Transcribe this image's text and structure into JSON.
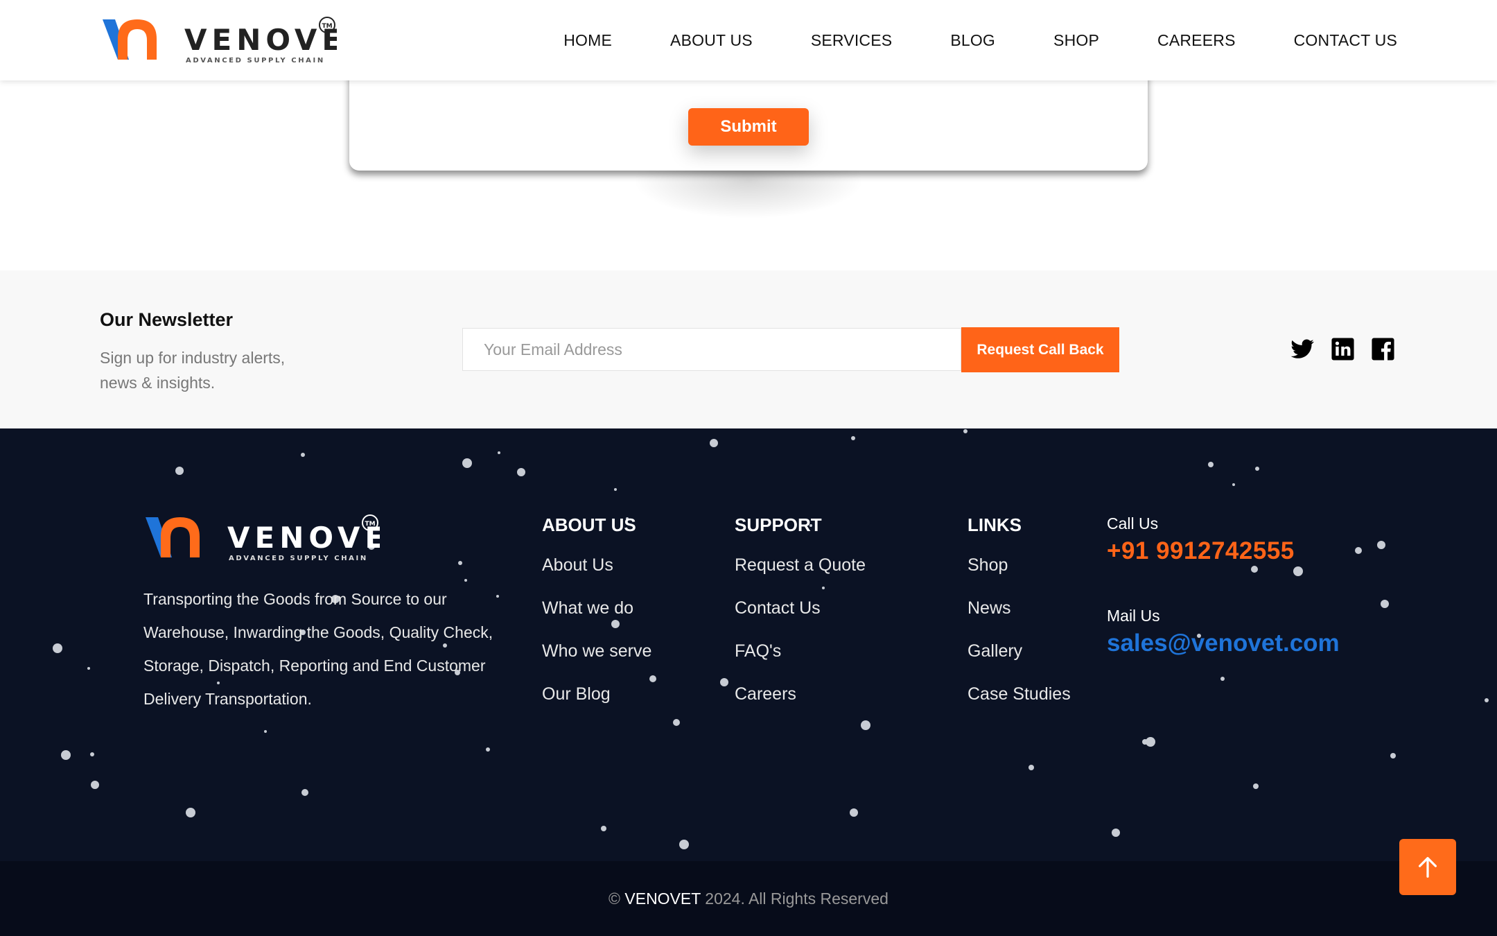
{
  "header": {
    "brand": "VENOVET",
    "tagline": "ADVANCED SUPPLY CHAIN",
    "trademark": "TM",
    "nav": [
      {
        "label": "HOME"
      },
      {
        "label": "ABOUT US"
      },
      {
        "label": "SERVICES"
      },
      {
        "label": "BLOG"
      },
      {
        "label": "SHOP"
      },
      {
        "label": "CAREERS"
      },
      {
        "label": "CONTACT US"
      }
    ]
  },
  "form": {
    "submit_label": "Submit"
  },
  "newsletter": {
    "title": "Our Newsletter",
    "subtitle": "Sign up for industry alerts, news & insights.",
    "email_placeholder": "Your Email Address",
    "email_value": "",
    "button_label": "Request Call Back",
    "social_icons": [
      "twitter-icon",
      "linkedin-icon",
      "facebook-icon"
    ]
  },
  "footer": {
    "brand": "VENOVET",
    "tagline": "ADVANCED SUPPLY CHAIN",
    "trademark": "TM",
    "description": "Transporting the Goods from Source to our Warehouse, Inwarding the Goods, Quality Check, Storage, Dispatch, Reporting and End Customer Delivery Transportation.",
    "columns": [
      {
        "title": "ABOUT US",
        "links": [
          "About Us",
          "What we do",
          "Who we serve",
          "Our Blog"
        ]
      },
      {
        "title": "SUPPORT",
        "links": [
          "Request a Quote",
          "Contact Us",
          "FAQ's",
          "Careers"
        ]
      },
      {
        "title": "LINKS",
        "links": [
          "Shop",
          "News",
          "Gallery",
          "Case Studies"
        ]
      }
    ],
    "contact": {
      "call_label": "Call Us",
      "phone": "+91 9912742555",
      "mail_label": "Mail Us",
      "email": "sales@venovet.com"
    },
    "copyright_prefix": "©",
    "copyright_brand": "VENOVET",
    "copyright_rest": "2024. All Rights Reserved"
  },
  "colors": {
    "accent": "#ff6418",
    "footer_bg": "#0b1224",
    "link_blue": "#1f74d9",
    "logo_blue": "#1f74d9",
    "logo_orange": "#ff6b1a"
  }
}
